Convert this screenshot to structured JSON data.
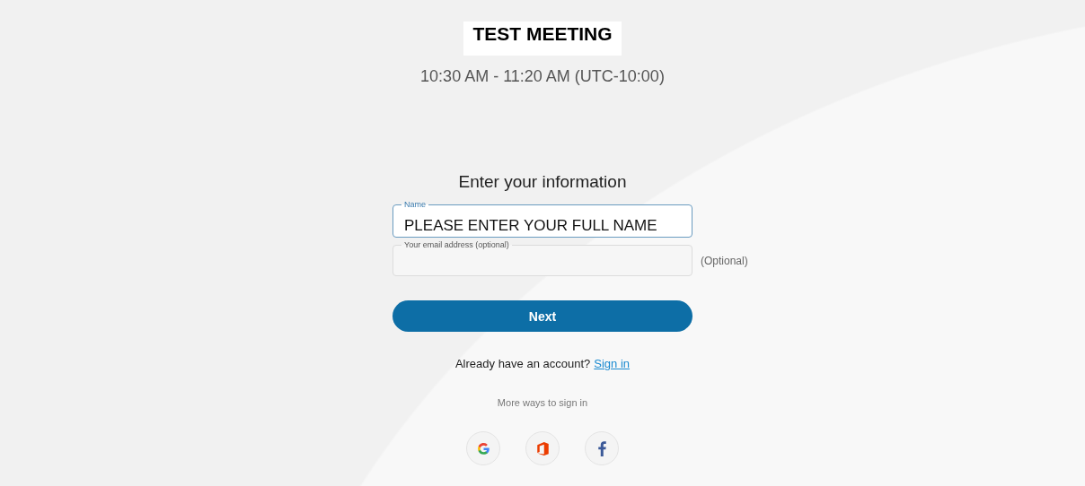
{
  "meeting": {
    "title": "TEST MEETING",
    "time": "10:30 AM - 11:20 AM (UTC-10:00)"
  },
  "form": {
    "heading": "Enter your information",
    "fields": [
      {
        "label": "Name",
        "value": "PLEASE ENTER YOUR FULL NAME",
        "focused": true
      },
      {
        "label": "Your email address (optional)",
        "focused": false,
        "note": "(Optional)"
      }
    ],
    "next_button": "Next",
    "account_prompt": "Already have an account?",
    "sign_in_link": "Sign in",
    "more_ways": "More ways to sign in"
  }
}
